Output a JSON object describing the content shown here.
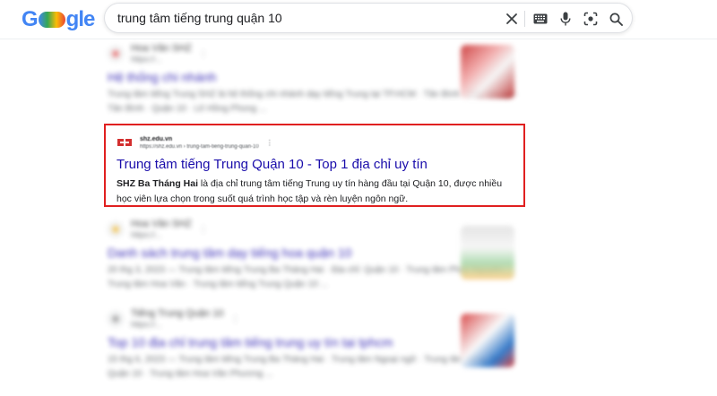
{
  "logo": {
    "text_g": "G",
    "text_le": "gle"
  },
  "search": {
    "query": "trung tâm tiếng trung quận 10"
  },
  "icons": {
    "clear": "close-icon",
    "keyboard": "keyboard-icon",
    "voice": "microphone-icon",
    "lens": "camera-lens-icon",
    "search": "search-icon"
  },
  "colors": {
    "link": "#1a0dab",
    "highlight_border": "#e02020"
  },
  "results": [
    {
      "site_name": "Hoa Văn SHZ",
      "url": "https://...",
      "title": "Hệ thống chi nhánh",
      "snippet": "Trung tâm tiếng Trung SHZ là hệ thống chi nhánh dạy tiếng Trung tại TP.HCM · Tân Bình · Phú Nhuận · Tân Bình · Quận 10 · Lê Hồng Phong ...",
      "blurred": true
    },
    {
      "site_name": "shz.edu.vn",
      "url": "https://shz.edu.vn › trung-tam-tieng-trung-quan-10",
      "title": "Trung tâm tiếng Trung Quận 10 - Top 1 địa chỉ uy tín",
      "snippet_bold": "SHZ Ba Tháng Hai",
      "snippet": " là địa chỉ trung tâm tiếng Trung uy tín hàng đầu tại Quận 10, được nhiều học viên lựa chọn trong suốt quá trình học tập và rèn luyện ngôn ngữ.",
      "blurred": false
    },
    {
      "site_name": "Hoa Văn SHZ",
      "url": "https://...",
      "title": "Danh sách trung tâm dạy tiếng hoa quận 10",
      "snippet": "20 thg 3, 2023 — Trung tâm tiếng Trung Ba Tháng Hai · Địa chỉ: Quận 10 · Trung tâm Phúc Nguyên · Trung tâm Hoa Văn · Trung tâm tiếng Trung Quận 10 ...",
      "blurred": true
    },
    {
      "site_name": "Tiếng Trung Quận 10",
      "url": "https://...",
      "title": "Top 10 địa chỉ trung tâm tiếng trung uy tín tại tphcm",
      "snippet": "15 thg 6, 2023 — Trung tâm tiếng Trung Ba Tháng Hai · Trung tâm Ngoại ngữ · Trung tâm tiếng Trung Quận 10 · Trung tâm Hoa Văn Phương ...",
      "blurred": true
    }
  ]
}
